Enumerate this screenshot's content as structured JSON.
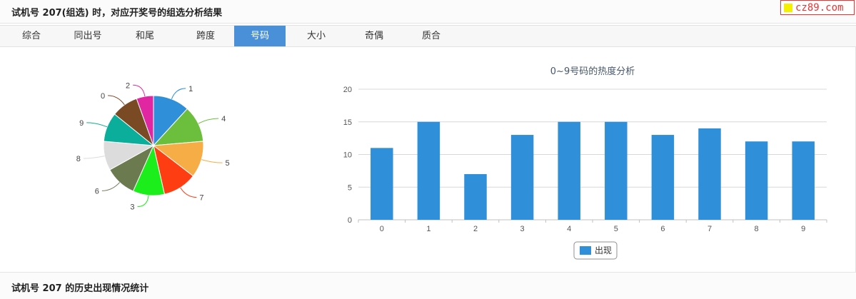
{
  "header": {
    "title": "试机号 207(组选) 时，对应开奖号的组选分析结果",
    "brand_text": "cz89.com"
  },
  "tabs": [
    {
      "label": "综合",
      "active": false
    },
    {
      "label": "同出号",
      "active": false
    },
    {
      "label": "和尾",
      "active": false
    },
    {
      "label": "跨度",
      "active": false
    },
    {
      "label": "号码",
      "active": true
    },
    {
      "label": "大小",
      "active": false
    },
    {
      "label": "奇偶",
      "active": false
    },
    {
      "label": "质合",
      "active": false
    }
  ],
  "chart_data": [
    {
      "type": "pie",
      "categories": [
        "1",
        "4",
        "5",
        "7",
        "3",
        "6",
        "8",
        "9",
        "0",
        "2"
      ],
      "values": [
        15,
        15,
        15,
        14,
        13,
        13,
        12,
        12,
        11,
        7
      ],
      "colors": [
        "#2f8fd8",
        "#6cbf3d",
        "#f7ad46",
        "#ff3d12",
        "#1cee1c",
        "#6b7a4f",
        "#dcdcdc",
        "#0bae9a",
        "#7a4a24",
        "#e026a0"
      ]
    },
    {
      "type": "bar",
      "title": "0~9号码的热度分析",
      "categories": [
        "0",
        "1",
        "2",
        "3",
        "4",
        "5",
        "6",
        "7",
        "8",
        "9"
      ],
      "series": [
        {
          "name": "出现",
          "values": [
            11,
            15,
            7,
            13,
            15,
            15,
            13,
            14,
            12,
            12
          ],
          "color": "#2f8fd8"
        }
      ],
      "ylim": [
        0,
        20
      ],
      "yticks": [
        "0",
        "5",
        "10",
        "15",
        "20"
      ],
      "grid": true,
      "legend": "bottom-center"
    }
  ],
  "footer": {
    "title": "试机号 207 的历史出现情况统计"
  }
}
